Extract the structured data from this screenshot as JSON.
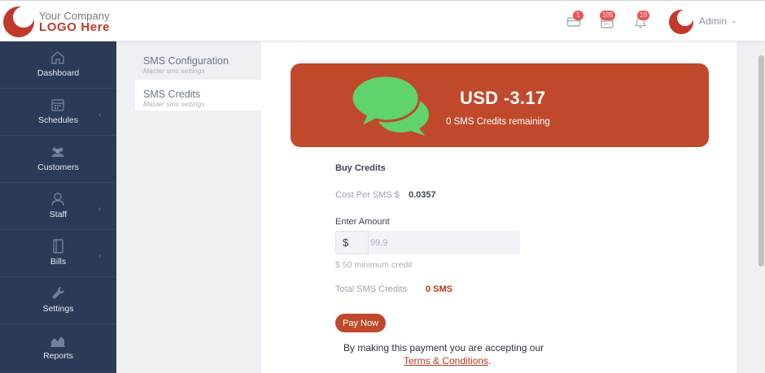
{
  "header": {
    "logo_line1": "Your Company",
    "logo_line2": "LOGO Here",
    "card_badge": "1",
    "calendar_badge": "105",
    "bell_badge": "10",
    "user_name": "Admin",
    "caret": "⌄"
  },
  "sidebar": {
    "items": [
      {
        "label": "Dashboard",
        "icon": "home-icon",
        "has_submenu": false
      },
      {
        "label": "Schedules",
        "icon": "calendar-icon",
        "has_submenu": true
      },
      {
        "label": "Customers",
        "icon": "users-icon",
        "has_submenu": false
      },
      {
        "label": "Staff",
        "icon": "user-icon",
        "has_submenu": true
      },
      {
        "label": "Bills",
        "icon": "book-icon",
        "has_submenu": true
      },
      {
        "label": "Settings",
        "icon": "wrench-icon",
        "has_submenu": false
      },
      {
        "label": "Reports",
        "icon": "chart-icon",
        "has_submenu": false
      }
    ],
    "caret": "‹"
  },
  "submenu": {
    "items": [
      {
        "title": "SMS Configuration",
        "desc": "Master sms settings",
        "active": false
      },
      {
        "title": "SMS Credits",
        "desc": "Master sms settings",
        "active": true
      }
    ]
  },
  "balance": {
    "amount": "USD -3.17",
    "remaining": "0 SMS Credits remaining"
  },
  "buy": {
    "title": "Buy Credits",
    "cost_label": "Cost Per SMS $",
    "cost_value": "0.0357",
    "amount_label": "Enter Amount",
    "currency_symbol": "$",
    "amount_placeholder": "99.9",
    "min_credit": "$ 50 minimum credit",
    "total_label": "Total SMS Credits",
    "total_value": "0 SMS",
    "pay_button": "Pay Now",
    "consent_text": "By making this payment you are accepting our",
    "terms_link": "Terms & Conditions",
    "terms_period": "."
  },
  "colors": {
    "brand": "#c0492b",
    "sidebar": "#2b3a56",
    "badge": "#ef5350",
    "bubble_green": "#5fd36c"
  }
}
